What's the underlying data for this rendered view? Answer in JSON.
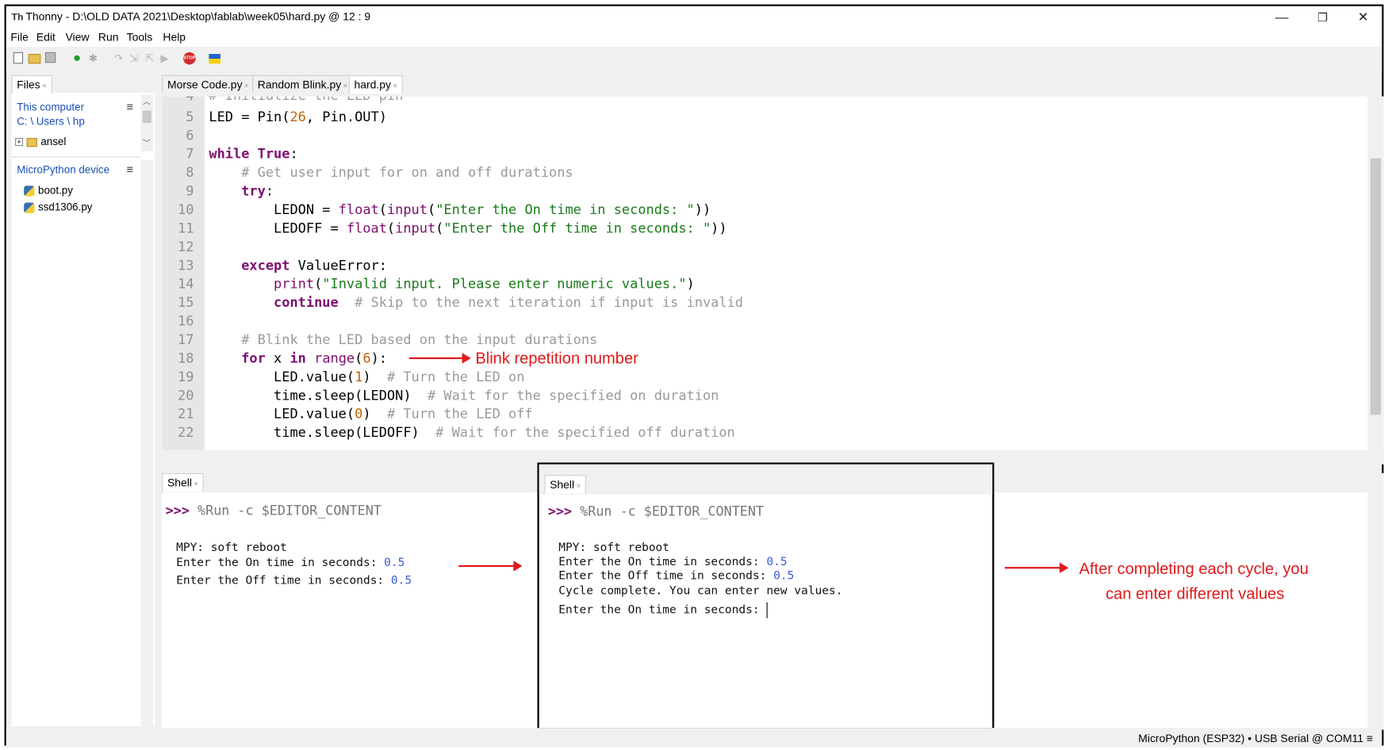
{
  "window": {
    "title": "Thonny  -  D:\\OLD DATA 2021\\Desktop\\fablab\\week05\\hard.py  @  12 : 9",
    "app_icon": "Th",
    "controls": {
      "minimize": "—",
      "restore": "❐",
      "close": "✕"
    }
  },
  "menu": {
    "items": [
      "File",
      "Edit",
      "View",
      "Run",
      "Tools",
      "Help"
    ]
  },
  "files": {
    "tab_label": "Files",
    "this_computer": "This computer",
    "path": "C: \\ Users \\ hp",
    "folder": "ansel",
    "device_label": "MicroPython device",
    "device_files": [
      "boot.py",
      "ssd1306.py"
    ]
  },
  "editor": {
    "tabs": [
      "Morse Code.py",
      "Random Blink.py",
      "hard.py"
    ],
    "active_tab": "hard.py",
    "partial_line": "# Initialize the LED pin",
    "line_numbers": [
      "4",
      "5",
      "6",
      "7",
      "8",
      "9",
      "10",
      "11",
      "12",
      "13",
      "14",
      "15",
      "16",
      "17",
      "18",
      "19",
      "20",
      "21",
      "22"
    ]
  },
  "annotations": {
    "blink_label": "Blink repetition number",
    "cycle_label_line1": "After completing each cycle, you",
    "cycle_label_line2": "can enter different values"
  },
  "shell_left": {
    "tab_label": "Shell",
    "prompt": ">>>",
    "command": " %Run -c $EDITOR_CONTENT",
    "line1": "MPY: soft reboot",
    "line2_label": "Enter the On time in seconds: ",
    "line2_value": "0.5",
    "line3_label": "Enter the Off time in seconds: ",
    "line3_value": "0.5"
  },
  "shell_right": {
    "tab_label": "Shell",
    "prompt": ">>>",
    "command": " %Run -c $EDITOR_CONTENT",
    "line1": "MPY: soft reboot",
    "line2_label": "Enter the On time in seconds: ",
    "line2_value": "0.5",
    "line3_label": "Enter the Off time in seconds: ",
    "line3_value": "0.5",
    "line4": "Cycle complete. You can enter new values.",
    "line5": "Enter the On time in seconds: "
  },
  "status": {
    "text": "MicroPython (ESP32)  •  USB Serial @ COM11  ≡"
  },
  "colors": {
    "annotation_red": "#e0191a",
    "keyword": "#7d0e6e",
    "string": "#1a7a1a",
    "number": "#c2620b",
    "comment": "#9a9a9a",
    "value_blue": "#3a5ad8"
  }
}
